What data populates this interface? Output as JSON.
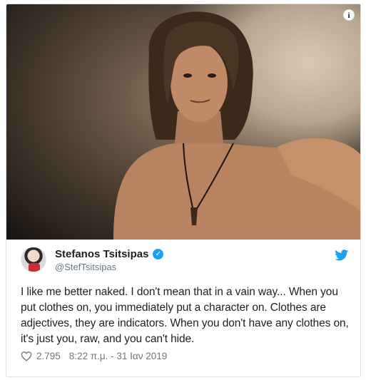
{
  "photo": {
    "alt_icon": "info-icon"
  },
  "info_glyph": "i",
  "author": {
    "name": "Stefanos Tsitsipas",
    "handle": "@StefTsitsipas",
    "verified_glyph": "✓"
  },
  "tweet": {
    "text": "I like me better naked. I don't mean that in a vain way... When you put clothes on, you immediately put a character on. Clothes are adjectives, they are indicators. When you don't have any clothes on, it's just you, raw, and you can't hide.",
    "likes": "2.795",
    "timestamp": "8:22 π.μ. - 31 Ιαν 2019"
  },
  "colors": {
    "twitter_blue": "#1da1f2",
    "text": "#1c2022",
    "muted": "#697882"
  }
}
